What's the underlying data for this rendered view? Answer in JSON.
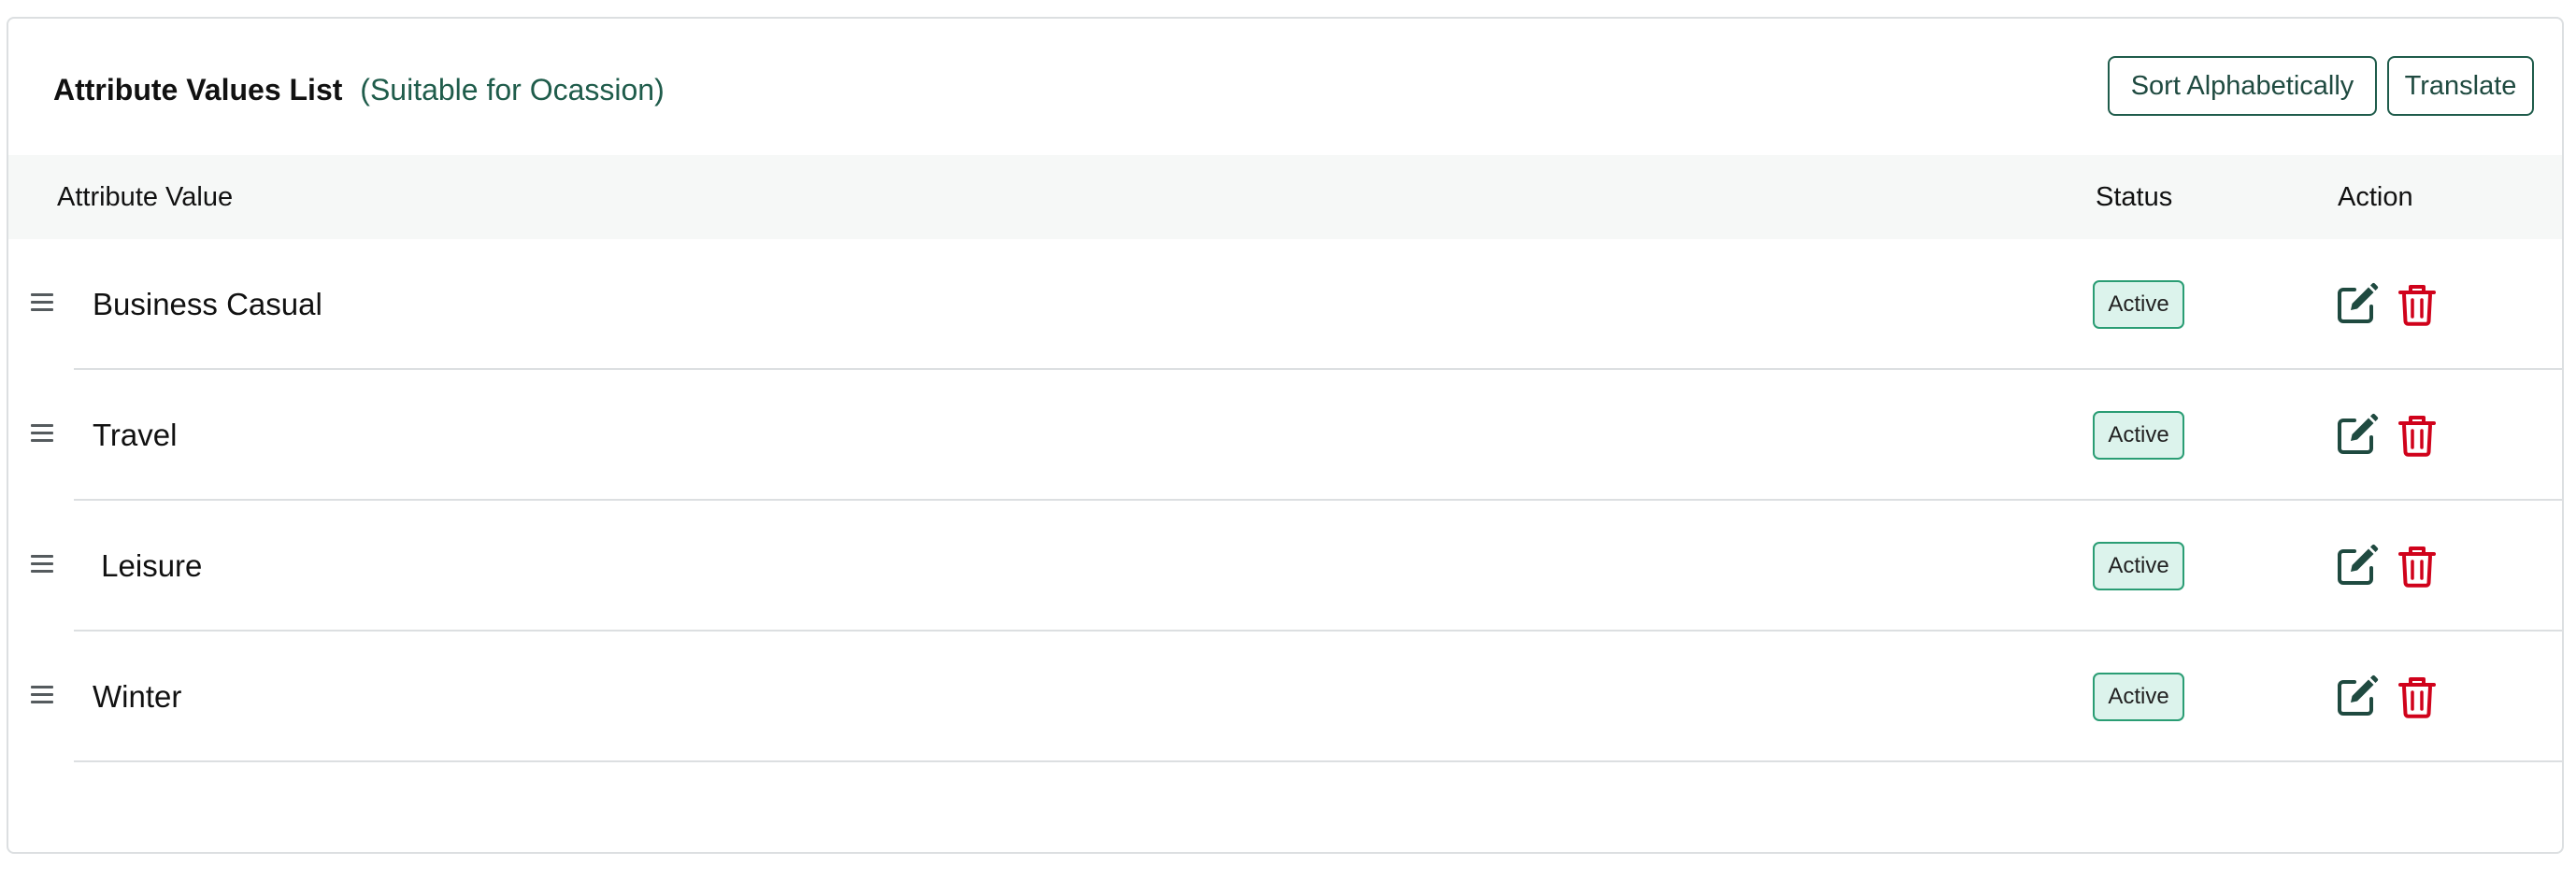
{
  "header": {
    "title": "Attribute Values List",
    "subtitle": "(Suitable for Ocassion)",
    "sort_label": "Sort Alphabetically",
    "translate_label": "Translate"
  },
  "table": {
    "columns": {
      "value": "Attribute Value",
      "status": "Status",
      "action": "Action"
    },
    "rows": [
      {
        "label": "Business Casual",
        "status": "Active"
      },
      {
        "label": "Travel",
        "status": "Active"
      },
      {
        "label": " Leisure",
        "status": "Active"
      },
      {
        "label": "Winter",
        "status": "Active"
      }
    ]
  },
  "icons": {
    "drag": "drag-handle-icon",
    "edit": "edit-icon",
    "delete": "trash-icon"
  },
  "colors": {
    "accent": "#1f5c4b",
    "badge_bg": "#dcf3ec",
    "badge_border": "#2a9d74",
    "delete": "#d0021b"
  }
}
